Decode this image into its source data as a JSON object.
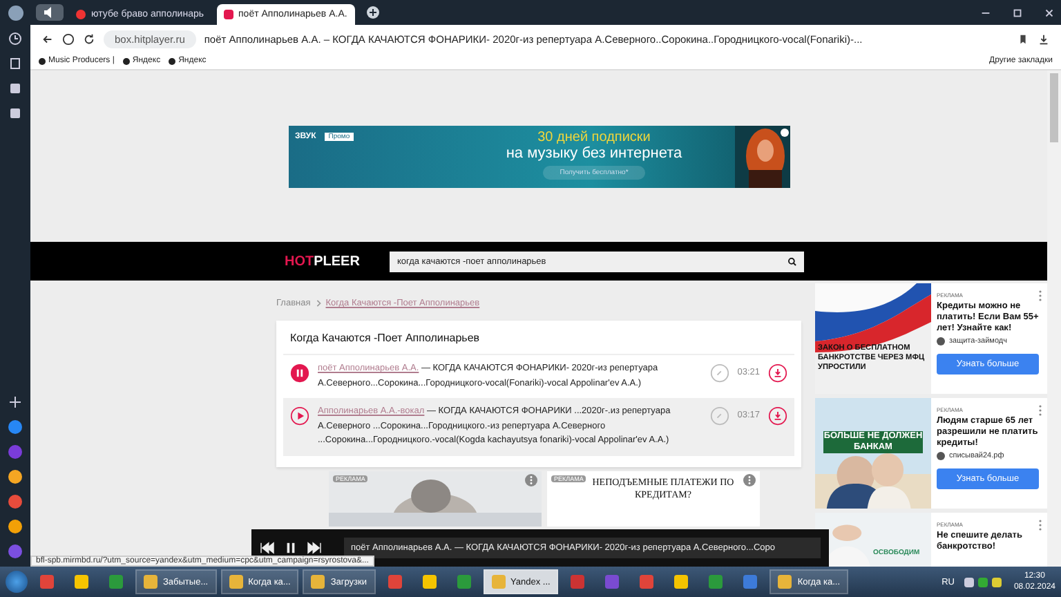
{
  "browser": {
    "tabs": [
      {
        "title": "ютубе браво апполинарь",
        "selected": false
      },
      {
        "title": "поёт Апполинарьев А.А.",
        "selected": true
      }
    ],
    "address": {
      "host": "box.hitplayer.ru",
      "title": "поёт Апполинарьев А.А. – КОГДА КАЧАЮТСЯ ФОНАРИКИ- 2020г-из репертуара А.Северного..Сорокина..Городницкого-vocal(Fonariki)-..."
    },
    "bookmarks": [
      "Music Producers |",
      "Яндекс",
      "Яндекс"
    ],
    "other_bookmarks": "Другие закладки"
  },
  "banner": {
    "brand": "ЗВУК",
    "badge": "Промо",
    "headline": "30 дней подписки",
    "subline": "на музыку без интернета",
    "button": "Получить бесплатно*"
  },
  "site": {
    "logo_accent": "HOT",
    "logo_rest": "PLEER",
    "search": {
      "value": "когда качаются -поет апполинарьев"
    }
  },
  "breadcrumbs": [
    {
      "label": "Главная"
    },
    {
      "label": "Когда Качаются -Поет Апполинарьев"
    }
  ],
  "card": {
    "title": "Когда Качаются -Поет Апполинарьев",
    "tracks": [
      {
        "artist": "поёт Апполинарьев А.А.",
        "title": "— КОГДА КАЧАЮТСЯ ФОНАРИКИ- 2020г-из репертуара А.Северного...Сорокина...Городницкого-vocal(Fonariki)-vocal Appolinar'ev A.A.)",
        "duration": "03:21",
        "playing": true,
        "selected": false
      },
      {
        "artist": "Апполинарьев А.А.-вокал",
        "title": "— КОГДА КАЧАЮТСЯ ФОНАРИКИ ...2020г-.из репертуара А.Северного ...Сорокина...Городницкого.-из репертуара А.Северного ...Сорокина...Городницкого.-vocal(Kogda kachayutsya fonariki)-vocal Appolinar'ev A.A.)",
        "duration": "03:17",
        "playing": false,
        "selected": true
      }
    ]
  },
  "side_ads": [
    {
      "label": "РЕКЛАМА",
      "image_text": "ЗАКОН О БЕСПЛАТНОМ БАНКРОТСТВЕ ЧЕРЕЗ МФЦ УПРОСТИЛИ",
      "text": "Кредиты можно не платить! Если Вам 55+ лет! Узнайте как!",
      "source": "защита-займодч",
      "button": "Узнать больше"
    },
    {
      "label": "РЕКЛАМА",
      "image_text": "БОЛЬШЕ НЕ ДОЛЖЕН БАНКАМ",
      "text": "Людям старше 65 лет разрешили не платить кредиты!",
      "source": "списывай24.рф",
      "button": "Узнать больше"
    },
    {
      "label": "РЕКЛАМА",
      "image_text": "ОСВОБОДИМ",
      "text": "Не спешите делать банкротство!"
    }
  ],
  "bottom_ads": [
    {
      "label": "РЕКЛАМА"
    },
    {
      "label": "РЕКЛАМА",
      "text": "НЕПОДЪЕМНЫЕ ПЛАТЕЖИ ПО КРЕДИТАМ?"
    }
  ],
  "player": {
    "now_playing": "поёт Апполинарьев А.А. — КОГДА КАЧАЮТСЯ ФОНАРИКИ- 2020г-из репертуара А.Северного...Соро"
  },
  "status_url": "bfl-spb.mirmbd.ru/?utm_source=yandex&utm_medium=cpc&utm_campaign=rsyrostova&...",
  "taskbar": {
    "items": [
      {
        "kind": "icon"
      },
      {
        "kind": "icon"
      },
      {
        "kind": "icon"
      },
      {
        "kind": "window",
        "label": "Забытые...",
        "selected": false
      },
      {
        "kind": "window",
        "label": "Когда ка...",
        "selected": false
      },
      {
        "kind": "window",
        "label": "Загрузки",
        "selected": false
      },
      {
        "kind": "icon"
      },
      {
        "kind": "icon"
      },
      {
        "kind": "icon"
      },
      {
        "kind": "window",
        "label": "Yandex ...",
        "selected": true
      },
      {
        "kind": "icon"
      },
      {
        "kind": "icon"
      },
      {
        "kind": "icon"
      },
      {
        "kind": "icon"
      },
      {
        "kind": "icon"
      },
      {
        "kind": "icon"
      },
      {
        "kind": "window",
        "label": "Когда ка...",
        "selected": false
      }
    ],
    "language": "RU",
    "time": "12:30",
    "date": "08.02.2024"
  }
}
